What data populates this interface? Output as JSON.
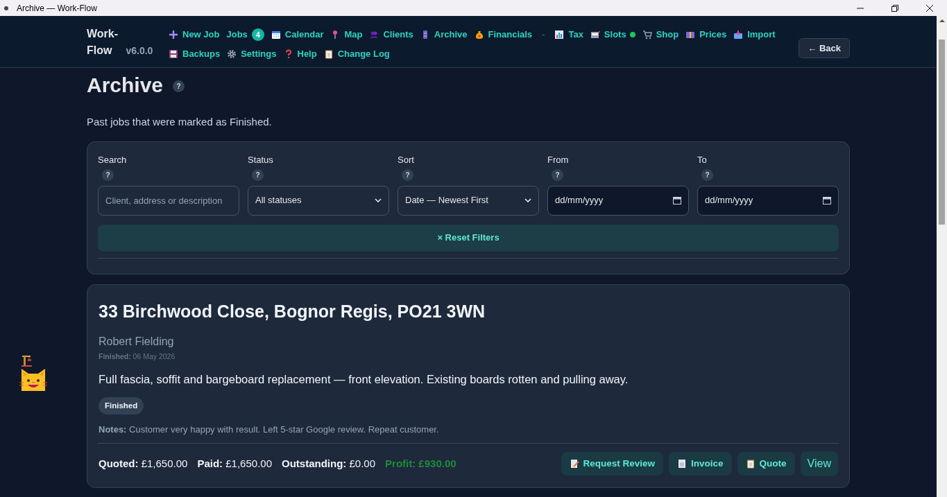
{
  "window": {
    "title": "Archive — Work-Flow"
  },
  "brand": {
    "name": "Work-Flow",
    "version": "v6.0.0"
  },
  "nav_rows": [
    [
      {
        "kind": "link",
        "label": "New Job",
        "live": false
      },
      {
        "kind": "link",
        "label": "Jobs",
        "badge": "4",
        "live": false
      },
      {
        "kind": "link",
        "label": "Calendar",
        "live": false
      },
      {
        "kind": "link",
        "label": "Map",
        "live": false
      },
      {
        "kind": "link",
        "label": "Clients",
        "live": false
      },
      {
        "kind": "link",
        "label": "Archive",
        "live": false
      },
      {
        "kind": "link",
        "label": "Financials",
        "live": false
      },
      {
        "kind": "separator",
        "label": "-"
      },
      {
        "kind": "link",
        "label": "Tax",
        "live": false
      },
      {
        "kind": "link",
        "label": "Slots",
        "live": true
      },
      {
        "kind": "link",
        "label": "Shop",
        "live": false
      },
      {
        "kind": "link",
        "label": "Prices",
        "live": false
      },
      {
        "kind": "link",
        "label": "Import",
        "live": false
      }
    ],
    [
      {
        "kind": "link",
        "label": "Backups",
        "live": false
      },
      {
        "kind": "link",
        "label": "Settings",
        "live": false
      },
      {
        "kind": "link",
        "label": "Help",
        "live": false
      },
      {
        "kind": "link",
        "label": "Change Log",
        "live": false
      }
    ]
  ],
  "back_button": "← Back",
  "page": {
    "title": "Archive",
    "help": "?",
    "subtitle": "Past jobs that were marked as Finished."
  },
  "filters": [
    {
      "kind": "text",
      "label": "Search",
      "help": "?",
      "placeholder": "Client, address or description"
    },
    {
      "kind": "select",
      "label": "Status",
      "help": "?",
      "value": "All statuses"
    },
    {
      "kind": "select",
      "label": "Sort",
      "help": "?",
      "value": "Date — Newest First"
    },
    {
      "kind": "date",
      "label": "From",
      "help": "?",
      "value": "dd/mm/yyyy"
    },
    {
      "kind": "date",
      "label": "To",
      "help": "?",
      "value": "dd/mm/yyyy"
    }
  ],
  "reset_button": "× Reset Filters",
  "jobs": [
    {
      "address": "33 Birchwood Close, Bognor Regis, PO21 3WN",
      "client": "Robert Fielding",
      "finished": "**Finished:** 06 May 2026",
      "description": "Full fascia, soffit and bargeboard replacement — front elevation. Existing boards rotten and pulling away.",
      "status": "Finished",
      "notes": "**Notes:** Customer very happy with result. Left 5-star Google review. Repeat customer.",
      "totals": [
        {
          "kind": "plain",
          "text": "**Quoted:** £1,650.00"
        },
        {
          "kind": "plain",
          "text": "**Paid:** £1,650.00"
        },
        {
          "kind": "plain",
          "text": "**Outstanding:** £0.00"
        },
        {
          "kind": "profit",
          "text": "Profit: £930.00"
        }
      ],
      "actions": [
        "Request Review",
        "Invoice",
        "Quote",
        "View"
      ]
    }
  ]
}
